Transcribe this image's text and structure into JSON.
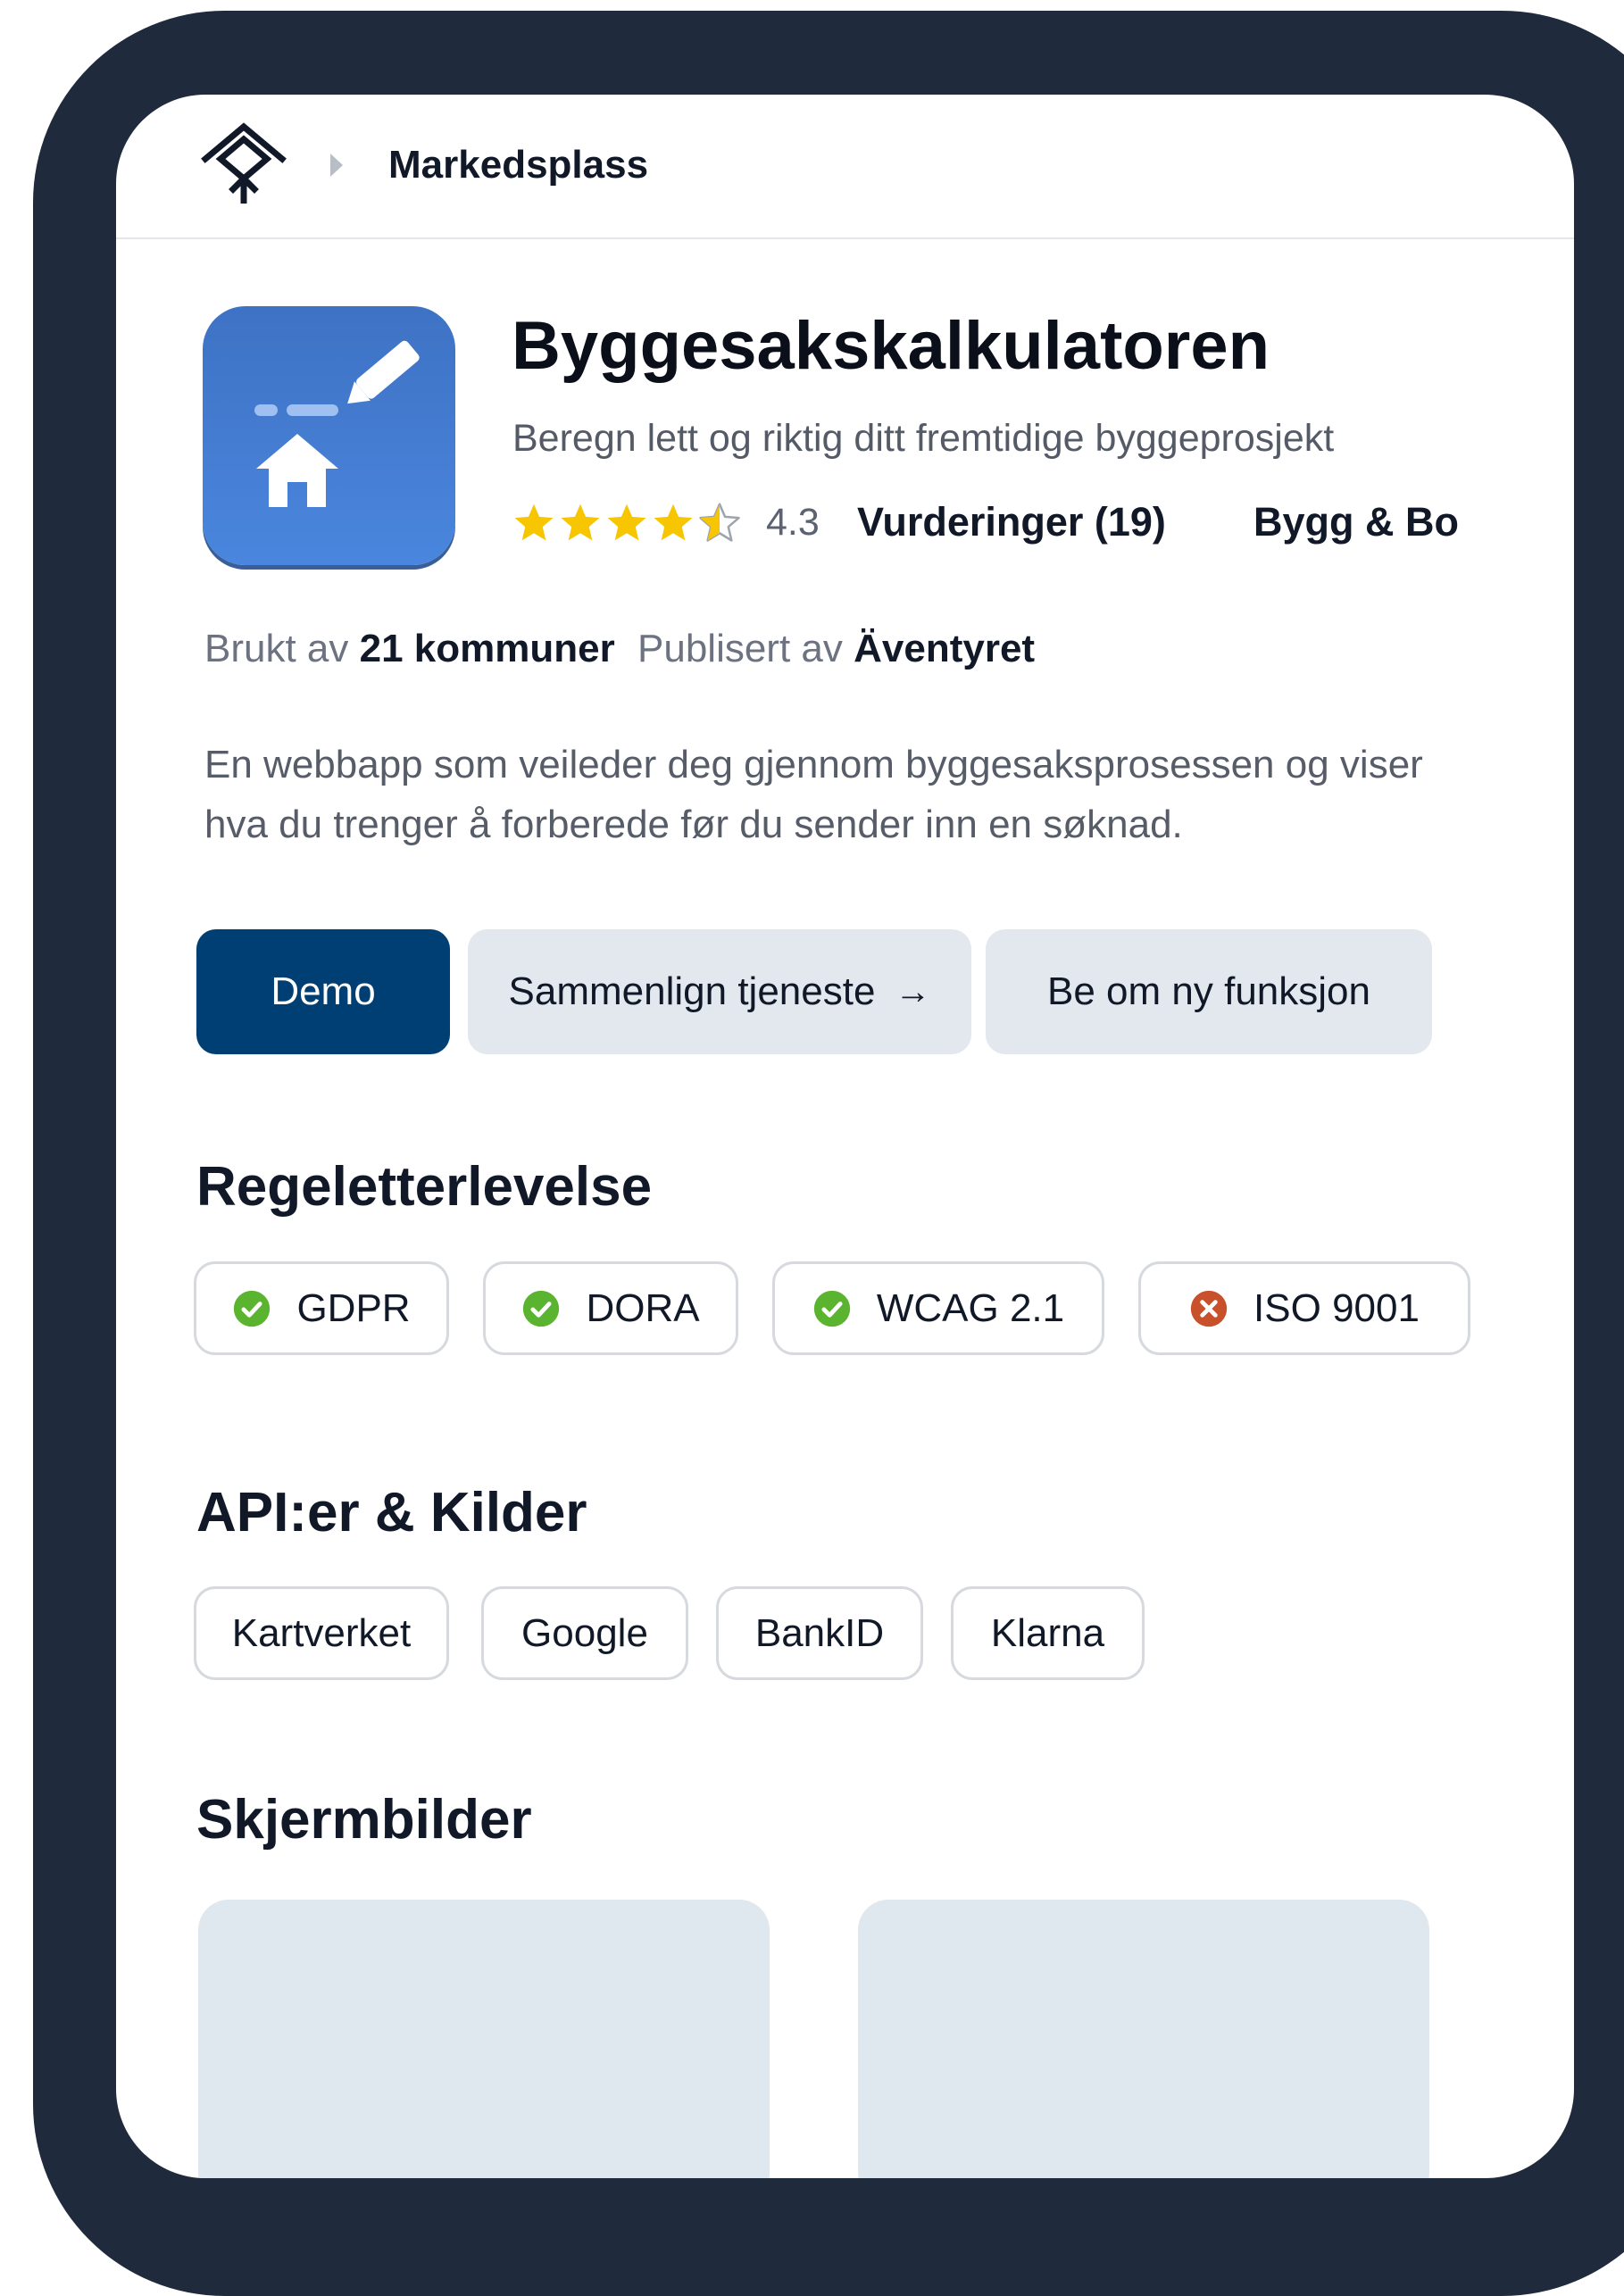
{
  "breadcrumb": {
    "title": "Markedsplass"
  },
  "app": {
    "name": "Byggesakskalkulatoren",
    "subtitle": "Beregn lett og riktig ditt fremtidige byggeprosjekt",
    "rating": 4.3,
    "rating_text": "4.3",
    "ratings_label": "Vurderinger (19)",
    "category": "Bygg & Bo",
    "used_by_label": "Brukt av",
    "used_by_value": "21 kommuner",
    "published_by_label": "Publisert av",
    "published_by_value": "Äventyret",
    "description": "En webbapp som veileder deg gjennom byggesaksprosessen og viser hva du trenger å forberede før du sender inn en søknad."
  },
  "actions": {
    "demo": "Demo",
    "compare": "Sammenlign tjeneste",
    "compare_arrow": "→",
    "request_feature": "Be om ny funksjon"
  },
  "compliance": {
    "title": "Regeletterlevelse",
    "items": [
      {
        "label": "GDPR",
        "status": "ok"
      },
      {
        "label": "DORA",
        "status": "ok"
      },
      {
        "label": "WCAG 2.1",
        "status": "ok"
      },
      {
        "label": "ISO 9001",
        "status": "fail"
      }
    ]
  },
  "apis": {
    "title": "API:er & Kilder",
    "items": [
      "Kartverket",
      "Google",
      "BankID",
      "Klarna"
    ]
  },
  "screenshots": {
    "title": "Skjermbilder"
  },
  "icons": {
    "logo": "marketplace-logo-icon",
    "breadcrumb_separator": "caret-right-icon",
    "app": "house-pencil-icon",
    "star": "star-icon",
    "ok": "check-circle-icon",
    "fail": "x-circle-icon"
  },
  "colors": {
    "frame": "#1f2a3c",
    "primary": "#003f74",
    "secondary_button": "#e3e8ef",
    "app_icon": "#4a86de",
    "star": "#f7c600",
    "ok": "#5bb42f",
    "fail": "#c8502a",
    "screenshot_placeholder": "#dfe8ef"
  }
}
